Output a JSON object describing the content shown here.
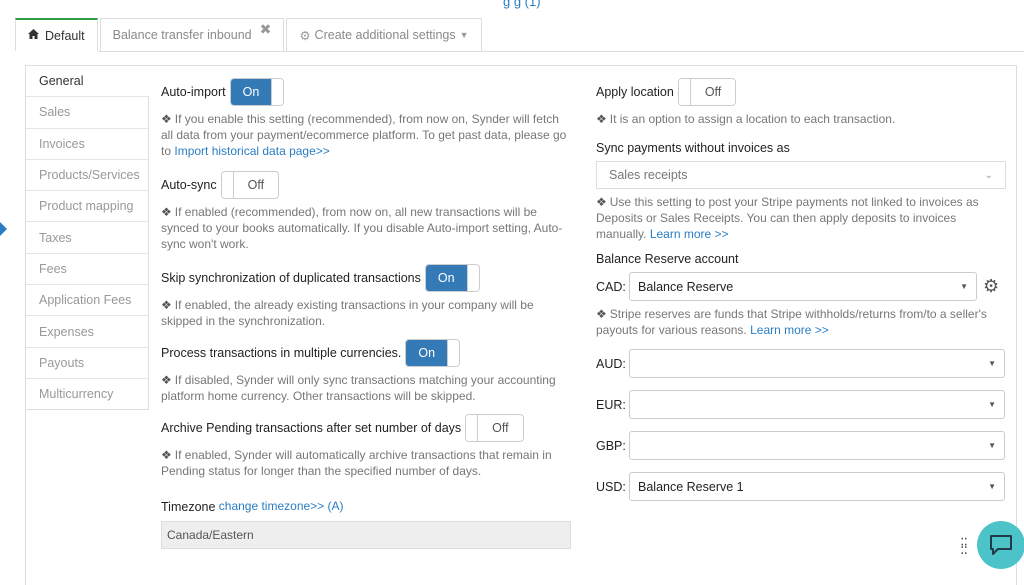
{
  "top_partial_text": "g g (1)",
  "tabs": [
    {
      "label": "Default",
      "icon": "home-icon"
    },
    {
      "label": "Balance transfer inbound",
      "close": "✖"
    },
    {
      "label": "Create additional settings"
    }
  ],
  "nav": [
    "General",
    "Sales",
    "Invoices",
    "Products/Services",
    "Product mapping",
    "Taxes",
    "Fees",
    "Application Fees",
    "Expenses",
    "Payouts",
    "Multicurrency"
  ],
  "left": {
    "auto_import": {
      "label": "Auto-import",
      "state": "On",
      "help": "If you enable this setting (recommended), from now on, Synder will fetch all data from your payment/ecommerce platform. To get past data, please go to",
      "link": "Import historical data page>>"
    },
    "auto_sync": {
      "label": "Auto-sync",
      "state": "Off",
      "help": "If enabled (recommended), from now on, all new transactions will be synced to your books automatically. If you disable Auto-import setting, Auto-sync won't work."
    },
    "skip_dup": {
      "label": "Skip synchronization of duplicated transactions",
      "state": "On",
      "help": "If enabled, the already existing transactions in your company will be skipped in the synchronization."
    },
    "multi_cur": {
      "label": "Process transactions in multiple currencies.",
      "state": "On",
      "help": "If disabled, Synder will only sync transactions matching your accounting platform home currency. Other transactions will be skipped."
    },
    "archive": {
      "label": "Archive Pending transactions after set number of days",
      "state": "Off",
      "help": "If enabled, Synder will automatically archive transactions that remain in Pending status for longer than the specified number of days."
    },
    "timezone": {
      "label": "Timezone",
      "link": "change timezone>> (A)",
      "value": "Canada/Eastern"
    }
  },
  "right": {
    "apply_location": {
      "label": "Apply location",
      "state": "Off",
      "help": "It is an option to assign a location to each transaction."
    },
    "sync_payments": {
      "label": "Sync payments without invoices as",
      "value": "Sales receipts",
      "help": "Use this setting to post your Stripe payments not linked to invoices as Deposits or Sales Receipts. You can then apply deposits to invoices manually.",
      "link": "Learn more >>"
    },
    "balance_reserve": {
      "label": "Balance Reserve account",
      "cad_label": "CAD:",
      "cad_value": "Balance Reserve",
      "help": "Stripe reserves are funds that Stripe withholds/returns from/to a seller's payouts for various reasons.",
      "link": "Learn more >>",
      "aud_label": "AUD:",
      "aud_value": "",
      "eur_label": "EUR:",
      "eur_value": "",
      "gbp_label": "GBP:",
      "gbp_value": "",
      "usd_label": "USD:",
      "usd_value": "Balance Reserve 1"
    }
  },
  "colors": {
    "accent": "#337ab7",
    "link": "#2a7dc4",
    "active_tab": "#2e9e44",
    "chat": "#4cc3c9"
  }
}
